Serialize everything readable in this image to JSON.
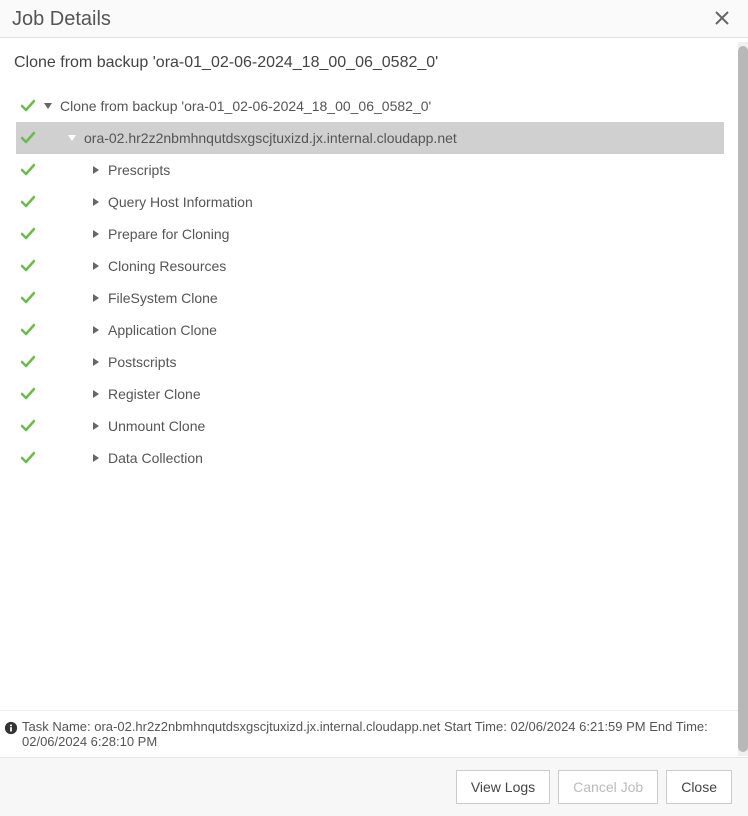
{
  "dialog": {
    "title": "Job Details"
  },
  "subtitle": "Clone from backup 'ora-01_02-06-2024_18_00_06_0582_0'",
  "tree": {
    "root": {
      "label": "Clone from backup 'ora-01_02-06-2024_18_00_06_0582_0'"
    },
    "host": {
      "label": "ora-02.hr2z2nbmhnqutdsxgscjtuxizd.jx.internal.cloudapp.net"
    },
    "steps": [
      {
        "label": "Prescripts"
      },
      {
        "label": "Query Host Information"
      },
      {
        "label": "Prepare for Cloning"
      },
      {
        "label": "Cloning Resources"
      },
      {
        "label": "FileSystem Clone"
      },
      {
        "label": "Application Clone"
      },
      {
        "label": "Postscripts"
      },
      {
        "label": "Register Clone"
      },
      {
        "label": "Unmount Clone"
      },
      {
        "label": "Data Collection"
      }
    ]
  },
  "footer": {
    "taskInfo": "Task Name: ora-02.hr2z2nbmhnqutdsxgscjtuxizd.jx.internal.cloudapp.net Start Time: 02/06/2024 6:21:59 PM End Time: 02/06/2024 6:28:10 PM",
    "buttons": {
      "viewLogs": "View Logs",
      "cancelJob": "Cancel Job",
      "close": "Close"
    }
  }
}
